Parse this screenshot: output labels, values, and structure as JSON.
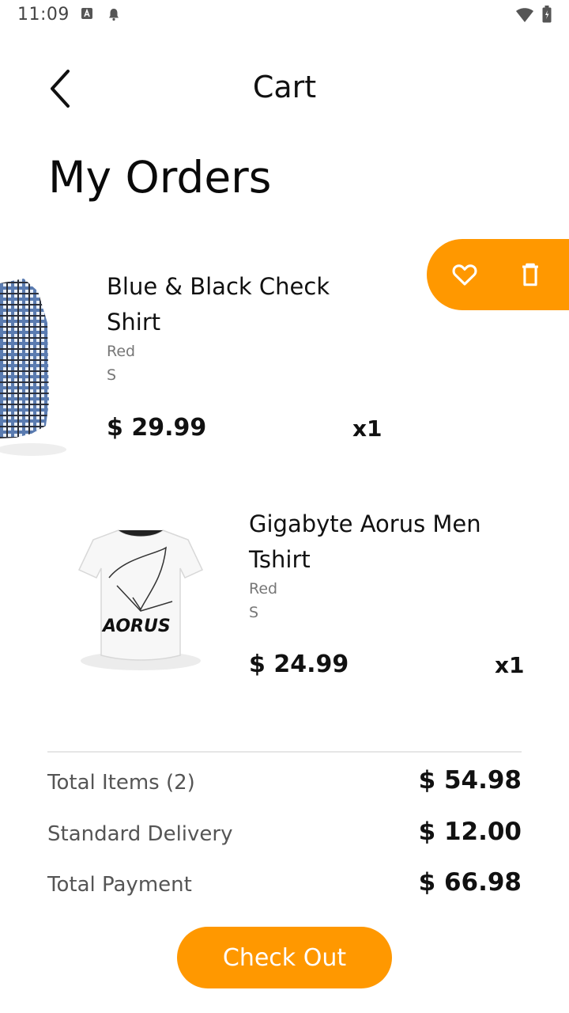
{
  "status_bar": {
    "time": "11:09"
  },
  "header": {
    "title": "Cart"
  },
  "page_title": "My Orders",
  "items": [
    {
      "name": "Blue & Black Check Shirt",
      "color": "Red",
      "size": "S",
      "price": "$ 29.99",
      "qty": "x1"
    },
    {
      "name": "Gigabyte Aorus Men Tshirt",
      "color": "Red",
      "size": "S",
      "price": "$ 24.99",
      "qty": "x1"
    }
  ],
  "summary": {
    "total_items_label": "Total Items (2)",
    "total_items_value": "$ 54.98",
    "delivery_label": "Standard Delivery",
    "delivery_value": "$ 12.00",
    "payment_label": "Total Payment",
    "payment_value": "$ 66.98"
  },
  "checkout_label": "Check Out",
  "colors": {
    "accent": "#FF9800"
  },
  "icons": [
    "back-arrow-icon",
    "heart-icon",
    "trash-icon"
  ]
}
